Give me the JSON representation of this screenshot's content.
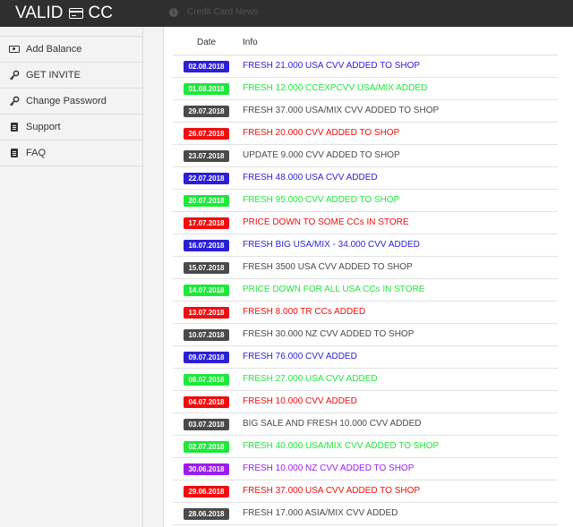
{
  "app": {
    "brand_left": "VALID",
    "brand_right": "CC",
    "crumb": "Credit Card News"
  },
  "sidebar": {
    "items": [
      {
        "label": "Add Balance",
        "icon": "money-icon"
      },
      {
        "label": "GET INVITE",
        "icon": "key-icon"
      },
      {
        "label": "Change Password",
        "icon": "key-icon"
      },
      {
        "label": "Support",
        "icon": "document-icon"
      },
      {
        "label": "FAQ",
        "icon": "document-icon"
      }
    ]
  },
  "table": {
    "headers": {
      "date": "Date",
      "info": "Info"
    },
    "colors": {
      "blue": "#2b1fd6",
      "green": "#1ee83a",
      "dark": "#4a4a4a",
      "red": "#f00d0d",
      "purple": "#9b1cf0"
    },
    "rows": [
      {
        "date": "02.08.2018",
        "info": "FRESH 21.000 USA CVV ADDED TO SHOP",
        "color": "blue"
      },
      {
        "date": "01.08.2018",
        "info": "FRESH 12.000 CCEXPCVV USA/MIX ADDED",
        "color": "green"
      },
      {
        "date": "29.07.2018",
        "info": "FRESH 37.000 USA/MIX CVV ADDED TO SHOP",
        "color": "dark"
      },
      {
        "date": "26.07.2018",
        "info": "FRESH 20.000 CVV ADDED TO SHOP",
        "color": "red"
      },
      {
        "date": "23.07.2018",
        "info": "UPDATE 9.000 CVV ADDED TO SHOP",
        "color": "dark"
      },
      {
        "date": "22.07.2018",
        "info": "FRESH 48.000 USA CVV ADDED",
        "color": "blue"
      },
      {
        "date": "20.07.2018",
        "info": "FRESH 95.000 CVV ADDED TO SHOP",
        "color": "green"
      },
      {
        "date": "17.07.2018",
        "info": "PRICE DOWN TO SOME CCs IN STORE",
        "color": "red"
      },
      {
        "date": "16.07.2018",
        "info": "FRESH BIG USA/MIX - 34.000 CVV ADDED",
        "color": "blue"
      },
      {
        "date": "15.07.2018",
        "info": "FRESH 3500 USA CVV ADDED TO SHOP",
        "color": "dark"
      },
      {
        "date": "14.07.2018",
        "info": "PRICE DOWN FOR ALL USA CCs IN STORE",
        "color": "green"
      },
      {
        "date": "13.07.2018",
        "info": "FRESH 8.000 TR CCs ADDED",
        "color": "red"
      },
      {
        "date": "10.07.2018",
        "info": "FRESH 30.000 NZ CVV ADDED TO SHOP",
        "color": "dark"
      },
      {
        "date": "09.07.2018",
        "info": "FRESH 76.000 CVV ADDED",
        "color": "blue"
      },
      {
        "date": "08.07.2018",
        "info": "FRESH 27.000 USA CVV ADDED",
        "color": "green"
      },
      {
        "date": "04.07.2018",
        "info": "FRESH 10.000 CVV ADDED",
        "color": "red"
      },
      {
        "date": "03.07.2018",
        "info": "BIG SALE AND FRESH 10.000 CVV ADDED",
        "color": "dark"
      },
      {
        "date": "02.07.2018",
        "info": "FRESH 40.000 USA/MIX CVV ADDED TO SHOP",
        "color": "green"
      },
      {
        "date": "30.06.2018",
        "info": "FRESH 10.000 NZ CVV ADDED TO SHOP",
        "color": "purple"
      },
      {
        "date": "29.06.2018",
        "info": "FRESH 37.000 USA CVV ADDED TO SHOP",
        "color": "red"
      },
      {
        "date": "28.06.2018",
        "info": "FRESH 17.000 ASIA/MIX CVV ADDED",
        "color": "dark"
      }
    ]
  }
}
